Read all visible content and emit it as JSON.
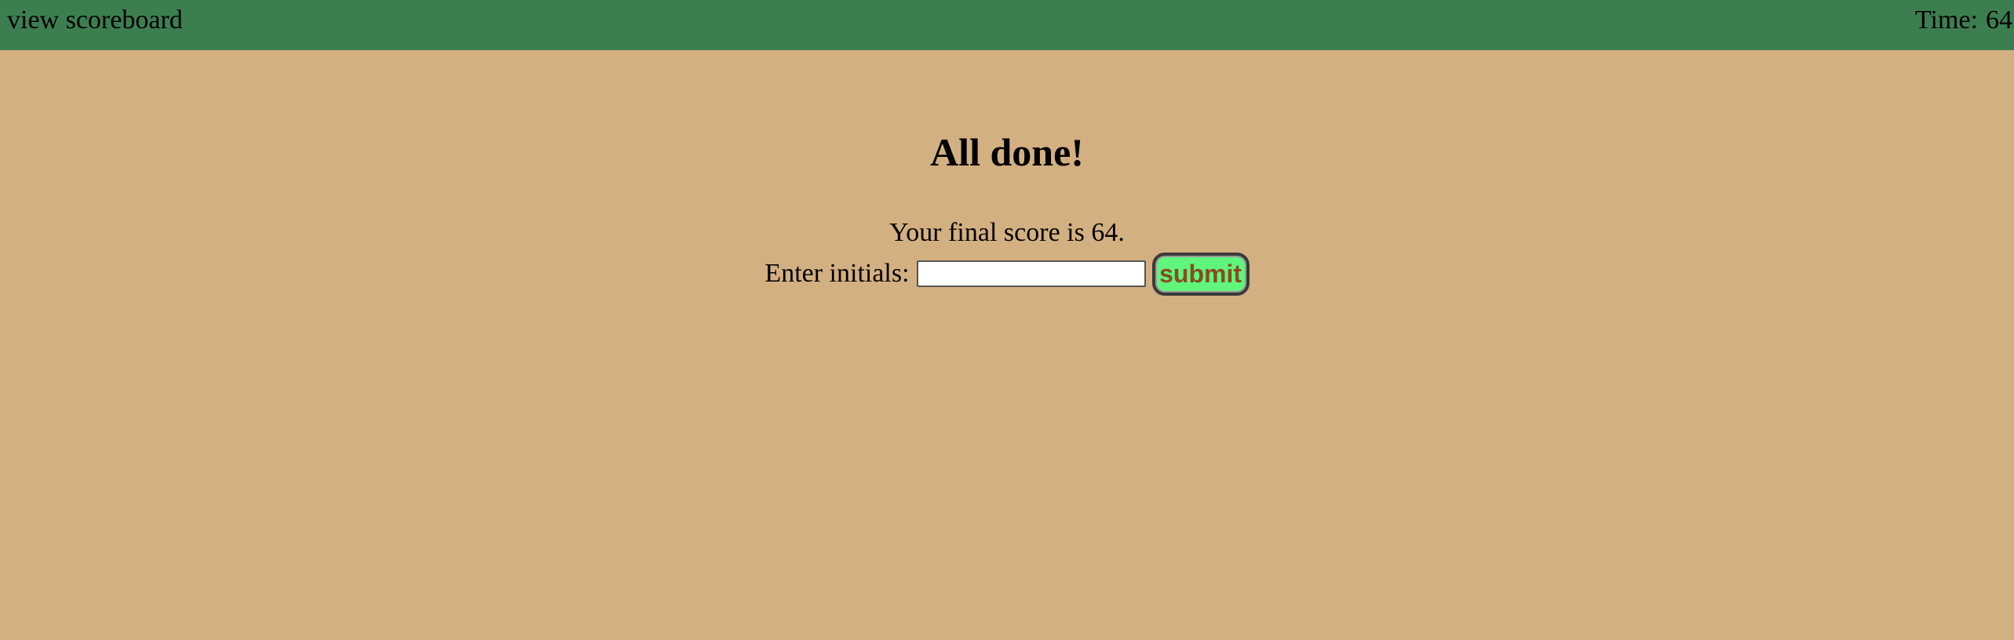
{
  "header": {
    "scoreboard_link": "view scoreboard",
    "timer_label": "Time:",
    "timer_value": "64"
  },
  "main": {
    "title": "All done!",
    "score_text": "Your final score is 64.",
    "initials_label": "Enter initials:",
    "initials_value": "",
    "initials_placeholder": "",
    "submit_label": "submit"
  },
  "colors": {
    "page_background": "#d3b081",
    "header_background": "#3d7e51",
    "submit_background": "#60f57b",
    "submit_text": "#8a4a22"
  }
}
